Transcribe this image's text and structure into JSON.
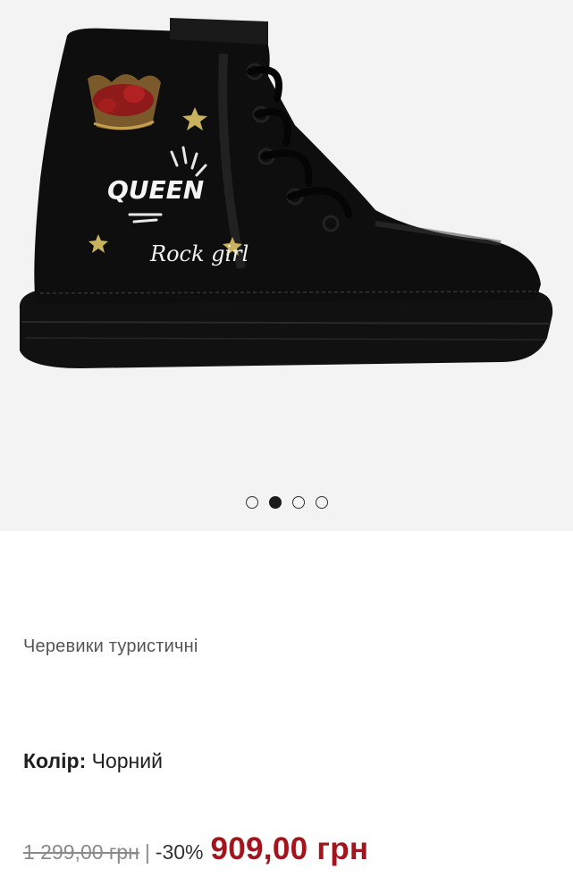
{
  "gallery": {
    "image_alt": "Black lace-up boot with QUEEN and Rock girl embroidery",
    "dots_count": 4,
    "active_index": 1,
    "boot_text_queen": "QUEEN",
    "boot_text_rockgirl": "Rock girl"
  },
  "product": {
    "name": "Черевики туристичні",
    "color_label": "Колір:",
    "color_value": "Чорний"
  },
  "price": {
    "old": "1 299,00 грн",
    "separator": "|",
    "discount": "-30%",
    "current": "909,00 грн"
  },
  "colors": {
    "price_accent": "#a3141c",
    "gallery_bg": "#f3f3f4"
  }
}
